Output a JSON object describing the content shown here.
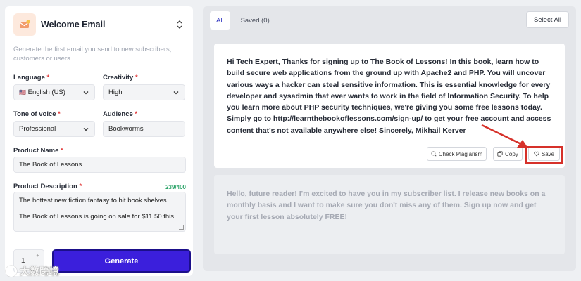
{
  "template": {
    "title": "Welcome Email",
    "description": "Generate the first email you send to new subscribers, customers or users.",
    "icon": "email-template-icon",
    "switch_icon": "chevron-updown-icon"
  },
  "form": {
    "language": {
      "label": "Language",
      "value": "English (US)",
      "flag": "🇺🇸"
    },
    "creativity": {
      "label": "Creativity",
      "value": "High"
    },
    "tone": {
      "label": "Tone of voice",
      "value": "Professional"
    },
    "audience": {
      "label": "Audience",
      "value": "Bookworms"
    },
    "product_name": {
      "label": "Product Name",
      "value": "The Book of Lessons"
    },
    "product_description": {
      "label": "Product Description",
      "counter": "239/400",
      "line1": "The hottest new fiction fantasy to hit book shelves.",
      "line2": "The Book of Lessons is going on sale for $11.50 this"
    },
    "required_mark": "*"
  },
  "quantity": {
    "value": "1",
    "up": "+",
    "down": "−"
  },
  "generate_label": "Generate",
  "watermark": "大数跨境",
  "results": {
    "tabs": [
      {
        "label": "All",
        "active": true
      },
      {
        "label": "Saved (0)",
        "active": false
      }
    ],
    "select_all_label": "Select All",
    "items": [
      {
        "text": "Hi Tech Expert, Thanks for signing up to The Book of Lessons! In this book, learn how to build secure web applications from the ground up with Apache2 and PHP. You will uncover various ways a hacker can steal sensitive information. This is essential knowledge for every developer and sysadmin that ever wants to work in the field of Information Security. To help you learn more about PHP security techniques, we're giving you some free lessons today. Simply go to http://learnthebookoflessons.com/sign-up/ to get your free account and access content that's not available anywhere else! Sincerely, Mikhail Kerver",
        "actions": {
          "plagiarism": "Check Plagiarism",
          "copy": "Copy",
          "save": "Save"
        }
      },
      {
        "text": "Hello, future reader! I'm excited to have you in my subscriber list. I release new books on a monthly basis and I want to make sure you don't miss any of them. Sign up now and get your first lesson absolutely FREE!"
      }
    ]
  },
  "colors": {
    "primary": "#3b1fdc",
    "highlight": "#d6312a",
    "counter": "#2fa56b"
  }
}
